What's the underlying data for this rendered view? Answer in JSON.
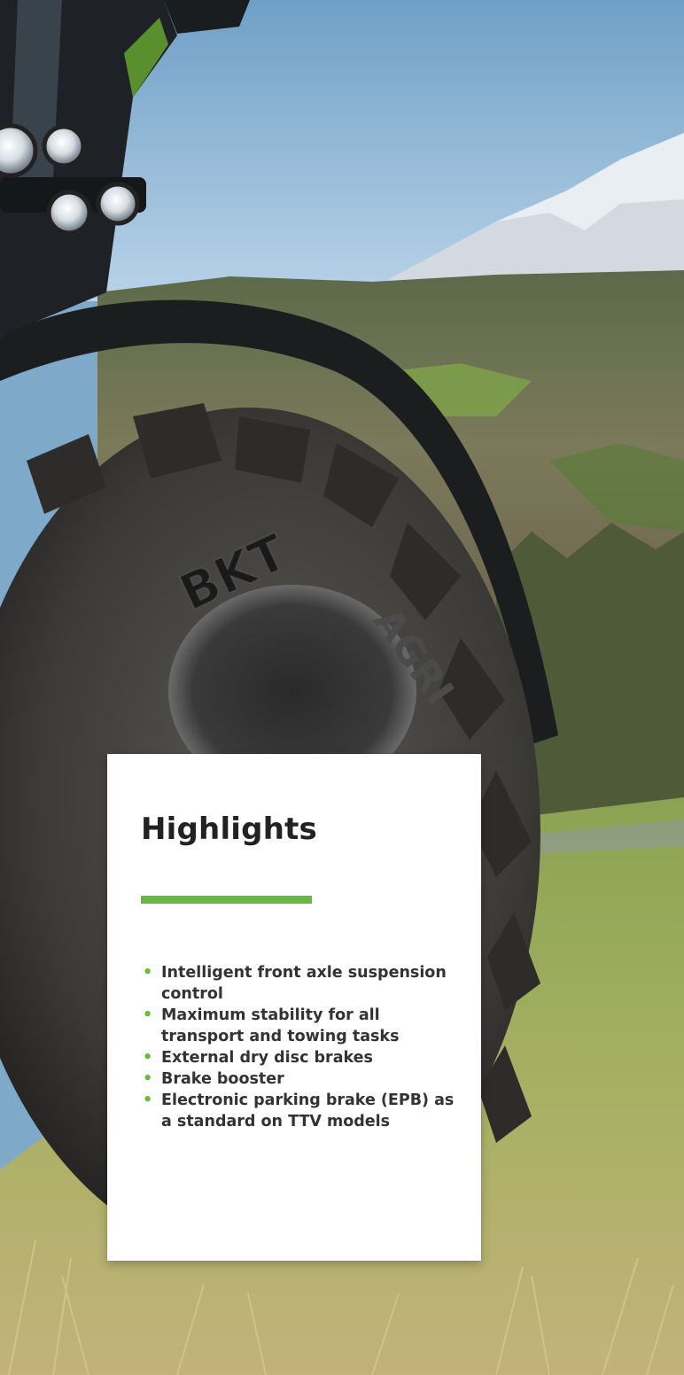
{
  "photo": {
    "description_icon": "tractor-tire-photo",
    "tire_brand_text": "BKT",
    "tire_model_text": "AGRI"
  },
  "highlights": {
    "title": "Highlights",
    "accent_color": "#69b83f",
    "items": [
      {
        "text": "Intelligent front axle suspension control"
      },
      {
        "text": "Maximum stability for all transport and towing tasks"
      },
      {
        "text": "External dry disc brakes"
      },
      {
        "text": "Brake booster"
      },
      {
        "text": "Electronic parking brake (EPB) as a standard on TTV models"
      }
    ]
  }
}
